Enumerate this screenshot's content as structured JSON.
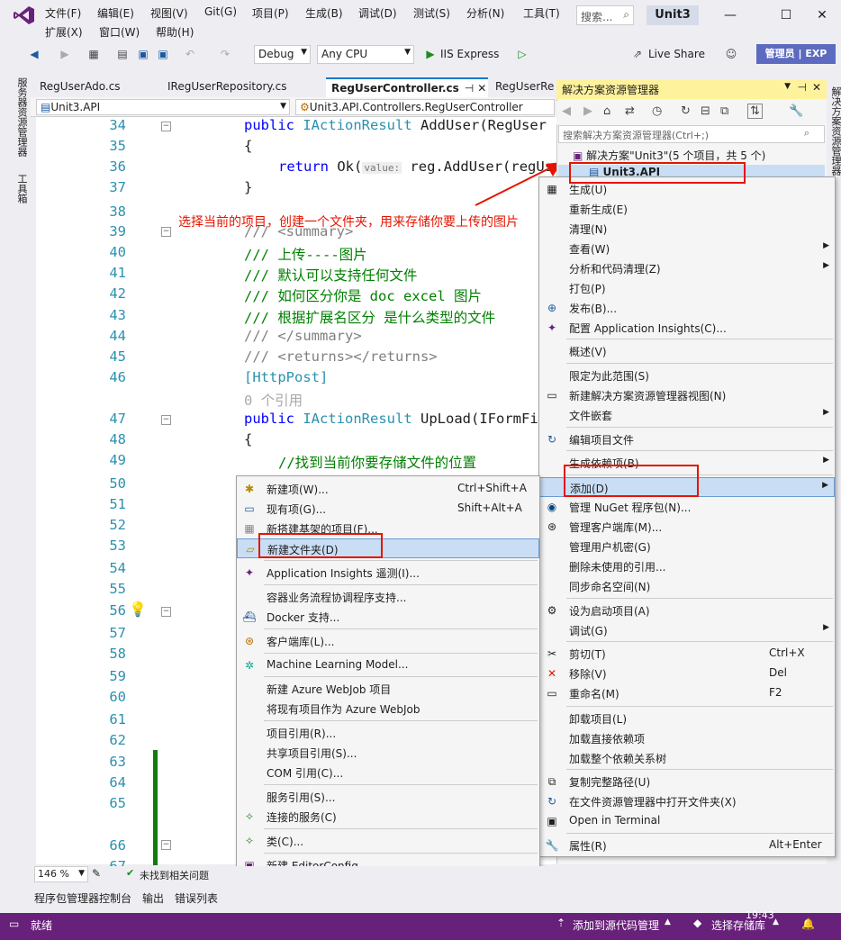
{
  "menu": {
    "file": "文件(F)",
    "edit": "编辑(E)",
    "view": "视图(V)",
    "git": "Git(G)",
    "project": "项目(P)",
    "build": "生成(B)",
    "debug": "调试(D)",
    "test": "测试(S)",
    "analyze": "分析(N)",
    "tools": "工具(T)",
    "extensions": "扩展(X)",
    "window": "窗口(W)",
    "help": "帮助(H)",
    "search_placeholder": "搜索...",
    "solution_name": "Unit3"
  },
  "toolbar": {
    "config": "Debug",
    "platform": "Any CPU",
    "run": "IIS Express",
    "live_share": "Live Share",
    "admin": "管理员",
    "exp": "EXP"
  },
  "left_strip": {
    "server_explorer": "服务器资源管理器",
    "toolbox": "工具箱"
  },
  "tabs": [
    "RegUserAdo.cs",
    "IRegUserRepository.cs",
    "RegUserController.cs",
    "RegUserRep"
  ],
  "navbar": {
    "project": "Unit3.API",
    "class": "Unit3.API.Controllers.RegUserController"
  },
  "code_lines": [
    {
      "n": "34",
      "t": ""
    },
    {
      "n": "35",
      "t": ""
    },
    {
      "n": "36",
      "t": ""
    },
    {
      "n": "37",
      "t": ""
    },
    {
      "n": "38",
      "t": ""
    },
    {
      "n": "39",
      "t": ""
    },
    {
      "n": "40",
      "t": ""
    },
    {
      "n": "41",
      "t": ""
    },
    {
      "n": "42",
      "t": ""
    },
    {
      "n": "43",
      "t": ""
    },
    {
      "n": "44",
      "t": ""
    },
    {
      "n": "45",
      "t": ""
    },
    {
      "n": "46",
      "t": ""
    },
    {
      "n": "47",
      "t": ""
    },
    {
      "n": "48",
      "t": ""
    },
    {
      "n": "49",
      "t": ""
    },
    {
      "n": "50",
      "t": ""
    },
    {
      "n": "51",
      "t": ""
    },
    {
      "n": "52",
      "t": ""
    },
    {
      "n": "53",
      "t": ""
    },
    {
      "n": "54",
      "t": ""
    },
    {
      "n": "55",
      "t": ""
    },
    {
      "n": "56",
      "t": ""
    },
    {
      "n": "57",
      "t": ""
    },
    {
      "n": "58",
      "t": ""
    },
    {
      "n": "59",
      "t": ""
    },
    {
      "n": "60",
      "t": ""
    },
    {
      "n": "61",
      "t": ""
    },
    {
      "n": "62",
      "t": ""
    },
    {
      "n": "63",
      "t": ""
    },
    {
      "n": "64",
      "t": ""
    },
    {
      "n": "65",
      "t": ""
    },
    {
      "n": "66",
      "t": ""
    },
    {
      "n": "67",
      "t": ""
    }
  ],
  "code": {
    "l34_kw": "public",
    "l34_ty": "IActionResult",
    "l34_rest": " AddUser(RegUser",
    "l35": "{",
    "l36_kw": "return",
    "l36_a": " Ok(",
    "l36_hint": "value:",
    "l36_b": " reg.AddUser(regUs",
    "l37": "}",
    "l39": "/// <summary>",
    "l40": "/// 上传----图片",
    "l41": "/// 默认可以支持任何文件",
    "l42": "/// 如何区分你是 doc excel 图片",
    "l43": "/// 根据扩展名区分 是什么类型的文件",
    "l44": "/// </summary>",
    "l45": "/// <returns></returns>",
    "l46": "[HttpPost]",
    "refs": "0 个引用",
    "l47_kw": "public",
    "l47_ty": "IActionResult",
    "l47_rest": " UpLoad(IFormFi",
    "l48": "{",
    "l49": "//找到当前你要存储文件的位置"
  },
  "annotation": "选择当前的项目，创建一个文件夹，用来存储你要上传的图片",
  "solution_explorer": {
    "title": "解决方案资源管理器",
    "search": "搜索解决方案资源管理器(Ctrl+;)",
    "solution": "解决方案\"Unit3\"(5 个项目，共 5 个)",
    "project": "Unit3.API",
    "side_label": "解决方案资源管理器"
  },
  "context_menu": [
    {
      "label": "生成(U)",
      "icon": "build-icon"
    },
    {
      "label": "重新生成(E)"
    },
    {
      "label": "清理(N)"
    },
    {
      "label": "查看(W)",
      "submenu": true
    },
    {
      "label": "分析和代码清理(Z)",
      "submenu": true
    },
    {
      "label": "打包(P)"
    },
    {
      "label": "发布(B)...",
      "icon": "globe-icon"
    },
    {
      "label": "配置 Application Insights(C)...",
      "icon": "insights-icon"
    },
    {
      "label": "概述(V)"
    },
    {
      "label": "限定为此范围(S)"
    },
    {
      "label": "新建解决方案资源管理器视图(N)",
      "icon": "window-icon"
    },
    {
      "label": "文件嵌套",
      "submenu": true
    },
    {
      "label": "编辑项目文件",
      "icon": "edit-icon"
    },
    {
      "label": "生成依赖项(B)",
      "submenu": true
    },
    {
      "label": "添加(D)",
      "submenu": true
    },
    {
      "label": "管理 NuGet 程序包(N)...",
      "icon": "nuget-icon"
    },
    {
      "label": "管理客户端库(M)...",
      "icon": "library-icon"
    },
    {
      "label": "管理用户机密(G)"
    },
    {
      "label": "删除未使用的引用..."
    },
    {
      "label": "同步命名空间(N)"
    },
    {
      "label": "设为启动项目(A)",
      "icon": "gear-icon"
    },
    {
      "label": "调试(G)",
      "submenu": true
    },
    {
      "label": "剪切(T)",
      "shortcut": "Ctrl+X",
      "icon": "scissors-icon"
    },
    {
      "label": "移除(V)",
      "shortcut": "Del",
      "icon": "delete-icon"
    },
    {
      "label": "重命名(M)",
      "shortcut": "F2",
      "icon": "rename-icon"
    },
    {
      "label": "卸载项目(L)"
    },
    {
      "label": "加载直接依赖项"
    },
    {
      "label": "加载整个依赖关系树"
    },
    {
      "label": "复制完整路径(U)",
      "icon": "copy-icon"
    },
    {
      "label": "在文件资源管理器中打开文件夹(X)",
      "icon": "folder-open-icon"
    },
    {
      "label": "Open in Terminal",
      "icon": "terminal-icon"
    },
    {
      "label": "属性(R)",
      "shortcut": "Alt+Enter",
      "icon": "wrench-icon"
    }
  ],
  "add_submenu": [
    {
      "label": "新建项(W)...",
      "shortcut": "Ctrl+Shift+A"
    },
    {
      "label": "现有项(G)...",
      "shortcut": "Shift+Alt+A"
    },
    {
      "label": "新搭建基架的项目(F)..."
    },
    {
      "label": "新建文件夹(D)"
    },
    {
      "label": "Application Insights 遥测(I)..."
    },
    {
      "label": "容器业务流程协调程序支持..."
    },
    {
      "label": "Docker 支持..."
    },
    {
      "label": "客户端库(L)..."
    },
    {
      "label": "Machine Learning Model..."
    },
    {
      "label": "新建 Azure WebJob 项目"
    },
    {
      "label": "将现有项目作为 Azure WebJob"
    },
    {
      "label": "项目引用(R)..."
    },
    {
      "label": "共享项目引用(S)..."
    },
    {
      "label": "COM 引用(C)..."
    },
    {
      "label": "服务引用(S)..."
    },
    {
      "label": "连接的服务(C)"
    },
    {
      "label": "类(C)..."
    },
    {
      "label": "新建 EditorConfig"
    }
  ],
  "editor_status": {
    "zoom": "146 %",
    "issues": "未找到相关问题"
  },
  "bottom_tabs": {
    "pkg": "程序包管理器控制台",
    "output": "输出",
    "errors": "错误列表"
  },
  "status_bar": {
    "ready": "就绪",
    "source_control": "添加到源代码管理",
    "repo": "选择存储库",
    "time": "19:43"
  }
}
